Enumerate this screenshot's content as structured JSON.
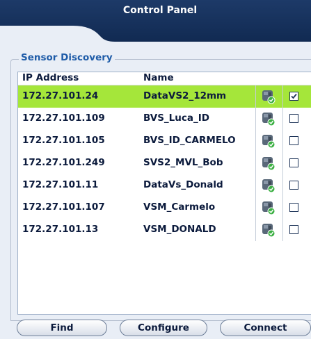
{
  "header": {
    "title": "Control Panel"
  },
  "sensor_discovery": {
    "legend": "Sensor Discovery",
    "columns": {
      "ip": "IP Address",
      "name": "Name"
    },
    "rows": [
      {
        "ip": "172.27.101.24",
        "name": "DataVS2_12mm",
        "status_icon": "sensor-online-icon",
        "checked": true,
        "selected": true
      },
      {
        "ip": "172.27.101.109",
        "name": "BVS_Luca_ID",
        "status_icon": "sensor-online-icon",
        "checked": false,
        "selected": false
      },
      {
        "ip": "172.27.101.105",
        "name": "BVS_ID_CARMELO",
        "status_icon": "sensor-online-icon",
        "checked": false,
        "selected": false
      },
      {
        "ip": "172.27.101.249",
        "name": "SVS2_MVL_Bob",
        "status_icon": "sensor-online-icon",
        "checked": false,
        "selected": false
      },
      {
        "ip": "172.27.101.11",
        "name": "DataVs_Donald",
        "status_icon": "sensor-online-icon",
        "checked": false,
        "selected": false
      },
      {
        "ip": "172.27.101.107",
        "name": "VSM_Carmelo",
        "status_icon": "sensor-online-icon",
        "checked": false,
        "selected": false
      },
      {
        "ip": "172.27.101.13",
        "name": "VSM_DONALD",
        "status_icon": "sensor-online-icon",
        "checked": false,
        "selected": false
      }
    ]
  },
  "buttons": {
    "find": "Find",
    "configure": "Configure",
    "connect": "Connect"
  },
  "colors": {
    "selected_row": "#a5e63a",
    "title_bar": "#112a52",
    "legend_text": "#1f5ca8",
    "online_badge": "#3cb043"
  }
}
